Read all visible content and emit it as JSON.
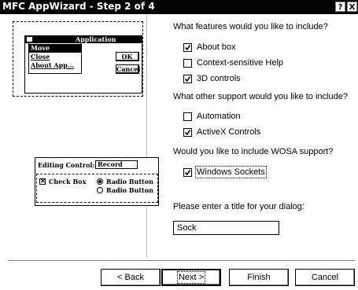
{
  "window": {
    "title": "MFC AppWizard - Step 2 of 4",
    "help_button": "?",
    "close_button": "X"
  },
  "illustration": {
    "app_window_title": "Application",
    "menu_items": [
      "Move",
      "Close",
      "About App..."
    ],
    "ok_label": "OK",
    "cancel_label": "Cancel",
    "editing_control_label": "Editing Control:",
    "editing_control_value": "Record",
    "check_box_label": "Check Box",
    "radio_button_1": "Radio Button",
    "radio_button_2": "Radio Button"
  },
  "features": {
    "question": "What features would you like to include?",
    "options": [
      {
        "label": "About box",
        "checked": true
      },
      {
        "label": "Context-sensitive Help",
        "checked": false
      },
      {
        "label": "3D controls",
        "checked": true
      }
    ]
  },
  "support": {
    "question": "What other support would you like to include?",
    "options": [
      {
        "label": "Automation",
        "checked": false
      },
      {
        "label": "ActiveX Controls",
        "checked": true
      }
    ]
  },
  "wosa": {
    "question": "Would you like to include WOSA support?",
    "options": [
      {
        "label": "Windows Sockets",
        "checked": true
      }
    ]
  },
  "dialog_title": {
    "prompt": "Please enter a title for your dialog:",
    "value": "Sock"
  },
  "buttons": {
    "back": "< Back",
    "next": "Next >",
    "finish": "Finish",
    "cancel": "Cancel"
  }
}
